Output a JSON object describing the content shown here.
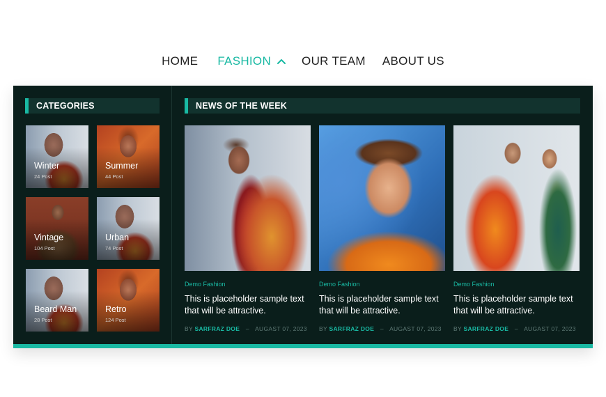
{
  "nav": {
    "items": [
      {
        "label": "HOME"
      },
      {
        "label": "FASHION"
      },
      {
        "label": "OUR TEAM"
      },
      {
        "label": "ABOUT US"
      }
    ],
    "active_color": "#19b9a3"
  },
  "categories": {
    "heading": "CATEGORIES",
    "items": [
      {
        "title": "Winter",
        "count": "24 Post"
      },
      {
        "title": "Summer",
        "count": "44 Post"
      },
      {
        "title": "Vintage",
        "count": "104 Post"
      },
      {
        "title": "Urban",
        "count": "74 Post"
      },
      {
        "title": "Beard Man",
        "count": "28 Post"
      },
      {
        "title": "Retro",
        "count": "124 Post"
      }
    ]
  },
  "news": {
    "heading": "NEWS OF THE WEEK",
    "posts": [
      {
        "category": "Demo Fashion",
        "title": "This is placeholder sample text that will be attractive.",
        "by": "BY",
        "author": "SARFRAZ DOE",
        "sep": "–",
        "date": "AUGAST 07, 2023"
      },
      {
        "category": "Demo Fashion",
        "title": "This is placeholder sample text that will be attractive.",
        "by": "BY",
        "author": "SARFRAZ DOE",
        "sep": "–",
        "date": "AUGAST 07, 2023"
      },
      {
        "category": "Demo Fashion",
        "title": "This is placeholder sample text that will be attractive.",
        "by": "BY",
        "author": "SARFRAZ DOE",
        "sep": "–",
        "date": "AUGAST 07, 2023"
      }
    ]
  },
  "theme": {
    "accent": "#19b9a3",
    "panel_bg": "#0a1e1b"
  }
}
